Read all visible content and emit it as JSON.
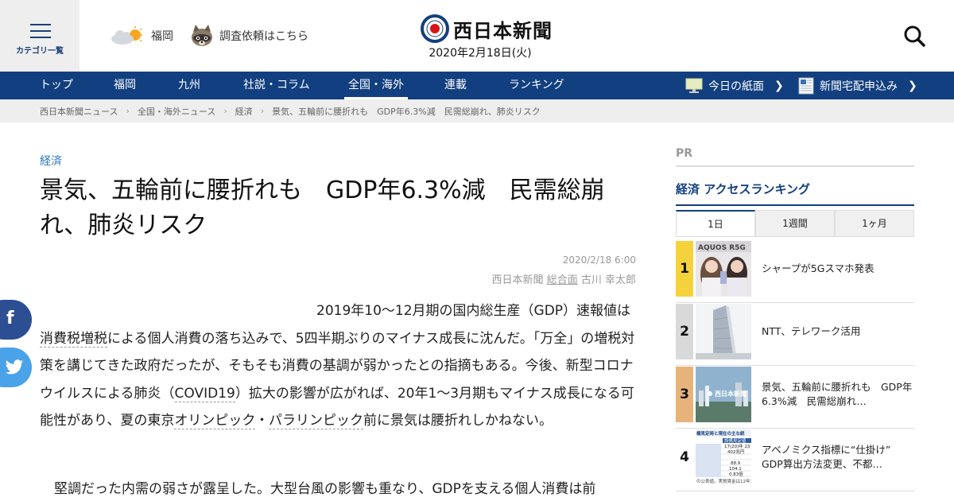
{
  "header": {
    "category_menu_label": "カテゴリ一覧",
    "weather_location": "福岡",
    "survey_link": "調査依頼はこちら",
    "logo_text": "西日本新聞",
    "date": "2020年2月18日(火)"
  },
  "nav": {
    "items": [
      "トップ",
      "福岡",
      "九州",
      "社説・コラム",
      "全国・海外",
      "連載",
      "ランキング"
    ],
    "active": "全国・海外",
    "today_paper": "今日の紙面",
    "delivery": "新聞宅配申込み"
  },
  "breadcrumb": [
    "西日本新聞ニュース",
    "全国・海外ニュース",
    "経済",
    "景気、五輪前に腰折れも　GDP年6.3%減　民需総崩れ、肺炎リスク"
  ],
  "article": {
    "category": "経済",
    "title": "景気、五輪前に腰折れも　GDP年6.3%減　民需総崩れ、肺炎リスク",
    "datetime": "2020/2/18 6:00",
    "source": "西日本新聞",
    "section": "総合面",
    "author": "古川 幸太郎",
    "p1_lead": "2019年10～12月期の国内総生産（GDP）速報値は",
    "kw_tax": "消費税増税",
    "p1_a": "による個人消費の落ち込みで、5四半期ぶりのマイナス成長に沈んだ。「万全」の増税対策を講じてきた政府だったが、そもそも消費の基調が弱かったとの指摘もある。今後、新型コロナウイルスによる肺炎（",
    "kw_covid": "COVID19",
    "p1_b": "）拡大の影響が広がれば、20年1～3月期もマイナス成長になる可能性があり、夏の東京",
    "kw_olympic": "オリンピック",
    "p1_c": "・",
    "kw_paralympic": "パラリンピック",
    "p1_d": "前に景気は腰折れしかねない。",
    "p2": "堅調だった内需の弱さが露呈した。大型台風の影響も重なり、GDPを支える個人消費は前"
  },
  "social": {
    "facebook": "f",
    "twitter": "t"
  },
  "sidebar": {
    "pr": "PR",
    "ranking_title": "経済 アクセスランキング",
    "tabs": [
      "1日",
      "1週間",
      "1ヶ月"
    ],
    "active_tab": "1日",
    "ranking": [
      {
        "rank": "1",
        "text": "シャープが5Gスマホ発表",
        "thumb_label": "AQUOS R5G",
        "badge": "#f5d23c"
      },
      {
        "rank": "2",
        "text": "NTT、テレワーク活用",
        "thumb_label": "",
        "badge": "#d9d9d9"
      },
      {
        "rank": "3",
        "text": "景気、五輪前に腰折れも　GDP年6.3%減　民需総崩れ…",
        "thumb_label": "西日本新聞",
        "badge": "#e8b37a"
      },
      {
        "rank": "4",
        "text": "アベノミクス指標に“仕掛け”　GDP算出方法変更、不都…",
        "thumb_label": "",
        "badge": "#ffffff"
      }
    ],
    "rank4_thumb_lines": [
      "構見定時と現在の主な統",
      "設備見定値",
      "17(20)年 23",
      "402兆円",
      "88.9",
      "104.1",
      "0.83倍",
      "の公表値。実質賃金は12年10月"
    ]
  }
}
